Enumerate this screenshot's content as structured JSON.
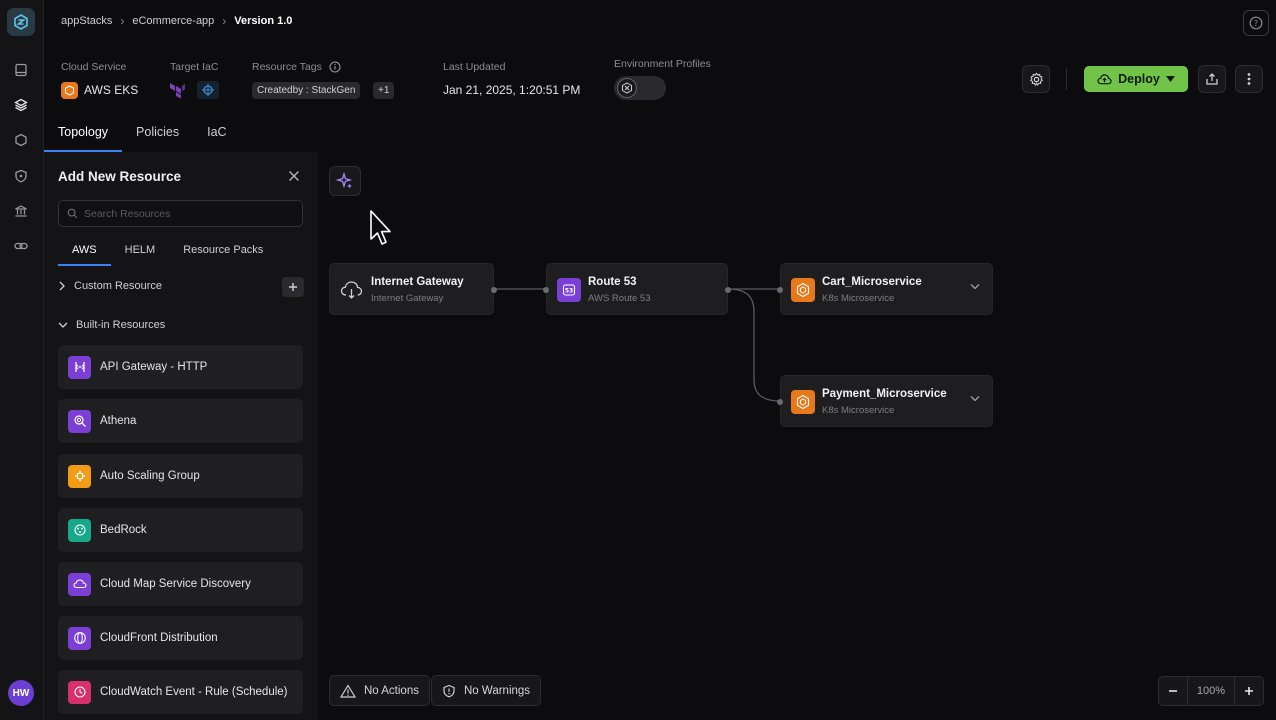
{
  "breadcrumb": [
    "appStacks",
    "eCommerce-app",
    "Version 1.0"
  ],
  "header": {
    "cloud_service_label": "Cloud Service",
    "cloud_service_value": "AWS EKS",
    "target_iac_label": "Target IaC",
    "resource_tags_label": "Resource Tags",
    "tag_primary": "Createdby : StackGen",
    "tag_more": "+1",
    "last_updated_label": "Last Updated",
    "last_updated_value": "Jan 21, 2025, 1:20:51 PM",
    "env_profiles_label": "Environment Profiles",
    "deploy_label": "Deploy"
  },
  "tabs": [
    "Topology",
    "Policies",
    "IaC"
  ],
  "panel": {
    "title": "Add New Resource",
    "search_placeholder": "Search Resources",
    "subtabs": [
      "AWS",
      "HELM",
      "Resource Packs"
    ],
    "custom_section": "Custom Resource",
    "builtin_section": "Built-in Resources",
    "items": [
      {
        "label": "API Gateway - HTTP",
        "color": "#7b3fd6",
        "icon": "api-gateway-icon"
      },
      {
        "label": "Athena",
        "color": "#7b3fd6",
        "icon": "athena-icon"
      },
      {
        "label": "Auto Scaling Group",
        "color": "#f29b15",
        "icon": "auto-scaling-icon"
      },
      {
        "label": "BedRock",
        "color": "#15a88a",
        "icon": "bedrock-icon"
      },
      {
        "label": "Cloud Map Service Discovery",
        "color": "#7b3fd6",
        "icon": "cloud-map-icon"
      },
      {
        "label": "CloudFront Distribution",
        "color": "#7b3fd6",
        "icon": "cloudfront-icon"
      },
      {
        "label": "CloudWatch Event - Rule (Schedule)",
        "color": "#d8306a",
        "icon": "cloudwatch-icon"
      }
    ]
  },
  "canvas": {
    "nodes": [
      {
        "title": "Internet Gateway",
        "subtitle": "Internet Gateway",
        "icon": "cloud-download-icon"
      },
      {
        "title": "Route 53",
        "subtitle": "AWS Route 53",
        "icon": "route53-icon",
        "color": "#7b3fd6"
      },
      {
        "title": "Cart_Microservice",
        "subtitle": "K8s Microservice",
        "icon": "k8s-microservice-icon",
        "color": "#e8791a"
      },
      {
        "title": "Payment_Microservice",
        "subtitle": "K8s Microservice",
        "icon": "k8s-microservice-icon",
        "color": "#e8791a"
      }
    ],
    "actions_label": "No Actions",
    "warnings_label": "No Warnings",
    "zoom_level": "100%"
  },
  "user": {
    "initials": "HW"
  },
  "colors": {
    "accent": "#3b82f6",
    "deploy": "#71c448",
    "aws_orange": "#e8791a"
  }
}
